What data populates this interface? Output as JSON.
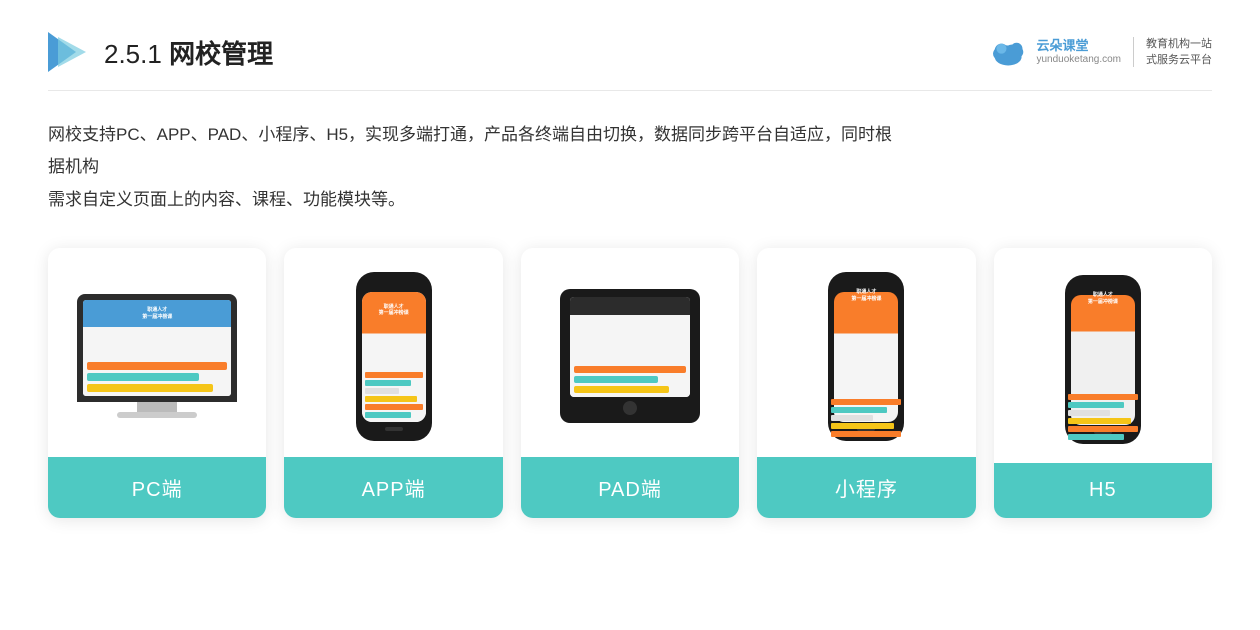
{
  "header": {
    "section_number": "2.5.1",
    "title_plain": "网校管理",
    "logo_alt": "云朵课堂",
    "brand_name": "云朵课堂",
    "brand_url": "yunduoketang.com",
    "slogan_line1": "教育机构一站",
    "slogan_line2": "式服务云平台"
  },
  "description": {
    "text_line1": "网校支持PC、APP、PAD、小程序、H5，实现多端打通，产品各终端自由切换，数据同步跨平台自适应，同时根据机构",
    "text_line2": "需求自定义页面上的内容、课程、功能模块等。"
  },
  "cards": [
    {
      "id": "pc",
      "label": "PC端"
    },
    {
      "id": "app",
      "label": "APP端"
    },
    {
      "id": "pad",
      "label": "PAD端"
    },
    {
      "id": "miniapp",
      "label": "小程序"
    },
    {
      "id": "h5",
      "label": "H5"
    }
  ],
  "colors": {
    "card_label_bg": "#4ec9c2",
    "card_label_text": "#ffffff",
    "accent_orange": "#f97d2a",
    "accent_teal": "#4ec9c2",
    "accent_yellow": "#f5c518",
    "accent_blue": "#4a9cd6"
  }
}
